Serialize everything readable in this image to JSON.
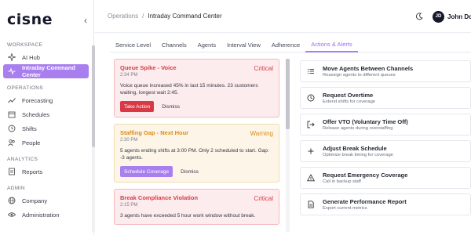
{
  "app": {
    "logo": "cisne"
  },
  "sidebar": {
    "sections": [
      {
        "label": "WORKSPACE",
        "items": [
          {
            "label": "AI Hub",
            "icon": "sparkle-icon"
          },
          {
            "label": "Intraday Command Center",
            "icon": "pulse-icon",
            "active": true
          }
        ]
      },
      {
        "label": "OPERATIONS",
        "items": [
          {
            "label": "Forecasting",
            "icon": "trend-icon"
          },
          {
            "label": "Schedules",
            "icon": "calendar-icon"
          },
          {
            "label": "Shifts",
            "icon": "clock-icon"
          },
          {
            "label": "People",
            "icon": "people-icon"
          }
        ]
      },
      {
        "label": "ANALYTICS",
        "items": [
          {
            "label": "Reports",
            "icon": "report-icon"
          }
        ]
      },
      {
        "label": "ADMIN",
        "items": [
          {
            "label": "Company",
            "icon": "building-icon"
          },
          {
            "label": "Administration",
            "icon": "eye-icon"
          }
        ]
      }
    ]
  },
  "header": {
    "breadcrumb": {
      "parent": "Operations",
      "separator": "/",
      "current": "Intraday Command Center"
    },
    "user": {
      "initials": "JD",
      "name": "John Doe"
    }
  },
  "tabs": [
    {
      "label": "Service Level"
    },
    {
      "label": "Channels"
    },
    {
      "label": "Agents"
    },
    {
      "label": "Interval View"
    },
    {
      "label": "Adherence"
    },
    {
      "label": "Actions & Alerts",
      "active": true
    }
  ],
  "alerts": [
    {
      "title": "Queue Spike - Voice",
      "severity": "Critical",
      "time": "2:34 PM",
      "message": "Voice queue increased 45% in last 15 minutes. 23 customers waiting, longest wait 2:45.",
      "action_label": "Take Action",
      "dismiss_label": "Dismiss",
      "level": "critical"
    },
    {
      "title": "Staffing Gap - Next Hour",
      "severity": "Warning",
      "time": "2:30 PM",
      "message": "5 agents ending shifts at 3:00 PM. Only 2 scheduled to start. Gap: -3 agents.",
      "action_label": "Schedule Coverage",
      "dismiss_label": "Dismiss",
      "level": "warning"
    },
    {
      "title": "Break Compliance Violation",
      "severity": "Critical",
      "time": "2:15 PM",
      "message": "3 agents have exceeded 5 hour work window without break.",
      "level": "critical"
    }
  ],
  "quick_actions": [
    {
      "title": "Move Agents Between Channels",
      "desc": "Reassign agents to different queues",
      "icon": "list-icon"
    },
    {
      "title": "Request Overtime",
      "desc": "Extend shifts for coverage",
      "icon": "clock-icon"
    },
    {
      "title": "Offer VTO (Voluntary Time Off)",
      "desc": "Release agents during overstaffing",
      "icon": "logout-icon"
    },
    {
      "title": "Adjust Break Schedule",
      "desc": "Optimize break timing for coverage",
      "icon": "plus-icon"
    },
    {
      "title": "Request Emergency Coverage",
      "desc": "Call in backup staff",
      "icon": "warning-icon"
    },
    {
      "title": "Generate Performance Report",
      "desc": "Export current metrics",
      "icon": "document-icon"
    }
  ],
  "colors": {
    "accent": "#a97ff0",
    "critical": "#d83a45",
    "warning": "#d98b14"
  }
}
